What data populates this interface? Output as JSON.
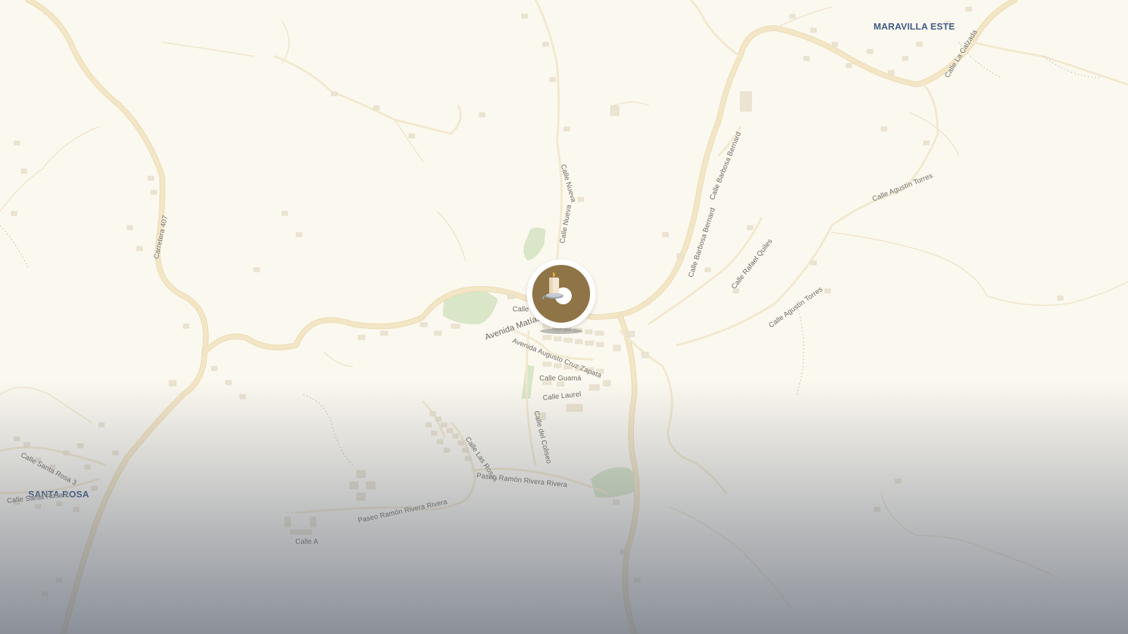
{
  "map": {
    "places": {
      "maravilla_este": "MARAVILLA ESTE",
      "santa_rosa": "SANTA ROSA"
    },
    "streets": {
      "carretera_407": "Carretera 407",
      "calle_nueva_1": "Calle Nueva",
      "calle_nueva_2": "Calle Nueva",
      "calle_barbosa_bernard_1": "Calle Barbosa Bernard",
      "calle_barbosa_bernard_2": "Calle Barbosa Bernard",
      "calle_rafael_quiles": "Calle Rafael Quiles",
      "calle_agustin_torres_1": "Calle Agustín Torres",
      "calle_agustin_torres_2": "Calle Agustín Torres",
      "calle_la_calzada": "Calle La Calzada",
      "avenida_matias": "Avenida Matías",
      "calle_short": "Calle",
      "avenida_augusto": "Avenida Augusto Cruz Zapata",
      "calle_guama": "Calle Guamá",
      "calle_laurel": "Calle Laurel",
      "calle_del_coliseo": "Calle del Coliseo",
      "calle_las_rosas": "Calle Las Rosas",
      "paseo_ramon_1": "Paseo Ramón Rivera Rivera",
      "paseo_ramon_2": "Paseo Ramón Rivera Rivera",
      "calle_santa_rosa_3": "Calle Santa Rosa 3",
      "calle_santa_rosa_2": "Calle Santa Rosa 2",
      "calle_a": "Calle A"
    },
    "marker": {
      "icon": "candle-icon",
      "color": "#8f7447"
    },
    "colors": {
      "land": "#fbf8ef",
      "road": "#f3e6c6",
      "park": "#d9e6c8",
      "place_label": "#3f5b85"
    }
  }
}
